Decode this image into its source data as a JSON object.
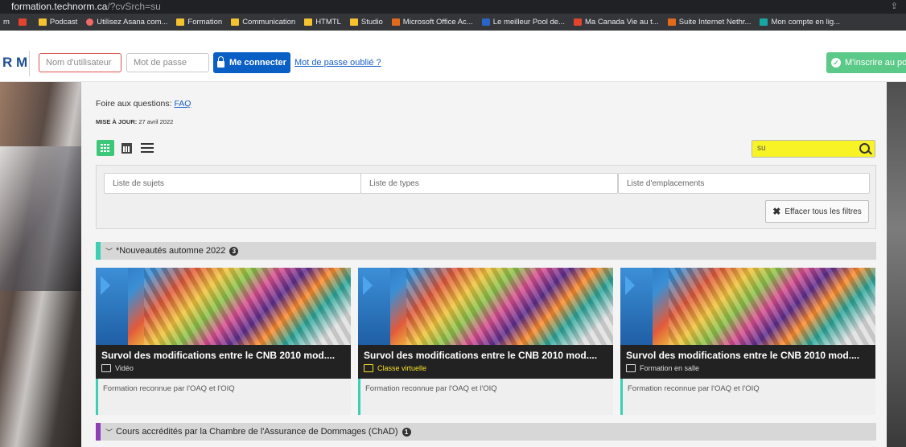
{
  "browser": {
    "url_host": "formation.technorm.ca",
    "url_path": "/?cvSrch=su",
    "share_icon": "share-icon",
    "bookmarks": [
      {
        "label": "m",
        "icon": "none"
      },
      {
        "label": "",
        "icon": "red"
      },
      {
        "label": "Podcast",
        "icon": "folder"
      },
      {
        "label": "Utilisez Asana com...",
        "icon": "asana"
      },
      {
        "label": "Formation",
        "icon": "folder"
      },
      {
        "label": "Communication",
        "icon": "folder"
      },
      {
        "label": "HTMTL",
        "icon": "folder"
      },
      {
        "label": "Studio",
        "icon": "folder"
      },
      {
        "label": "Microsoft Office Ac...",
        "icon": "orange"
      },
      {
        "label": "Le meilleur Pool de...",
        "icon": "blue"
      },
      {
        "label": "Ma Canada Vie au t...",
        "icon": "red"
      },
      {
        "label": "Suite Internet Nethr...",
        "icon": "orange"
      },
      {
        "label": "Mon compte en lig...",
        "icon": "teal"
      }
    ]
  },
  "header": {
    "logo": "R M",
    "username_placeholder": "Nom d'utilisateur",
    "password_placeholder": "Mot de passe",
    "login_label": "Me connecter",
    "forgot_label": "Mot de passe oublié ?",
    "signup_label": "M'inscrire au por"
  },
  "main": {
    "faq_prefix": "Foire aux questions: ",
    "faq_link": "FAQ",
    "update_label": "MISE À JOUR: ",
    "update_date": "27 avril 2022",
    "search_value": "su",
    "filters": {
      "subjects": "Liste de sujets",
      "types": "Liste de types",
      "locations": "Liste d'emplacements",
      "clear": "Effacer tous les filtres"
    },
    "categories": [
      {
        "title": "*Nouveautés automne 2022",
        "count": "3",
        "accent": "#3ccfb3"
      },
      {
        "title": "Cours accrédités par la Chambre de l'Assurance de Dommages (ChAD)",
        "count": "1",
        "accent": "#8e3fb5"
      }
    ],
    "cards": [
      {
        "title": "Survol des modifications entre le CNB 2010 mod....",
        "title_hl": "",
        "title_rest": "",
        "type": "Vidéo",
        "footer": "Formation reconnue par l'OAQ et l'OIQ"
      },
      {
        "title_pre": "Survol des modi",
        "title_hl": "",
        "title_rest": "fications entre le CNB 2010 mod....",
        "type": "Classe virtuelle",
        "footer": "Formation reconnue par l'OAQ et l'OIQ"
      },
      {
        "title": "Survol des modifications entre le CNB 2010 mod....",
        "type": "Formation en salle",
        "footer": "Formation reconnue par l'OAQ et l'OIQ"
      }
    ]
  },
  "colors": {
    "accent_green": "#3cc77a",
    "login_blue": "#0a5fc4",
    "search_highlight": "#f7f325"
  }
}
